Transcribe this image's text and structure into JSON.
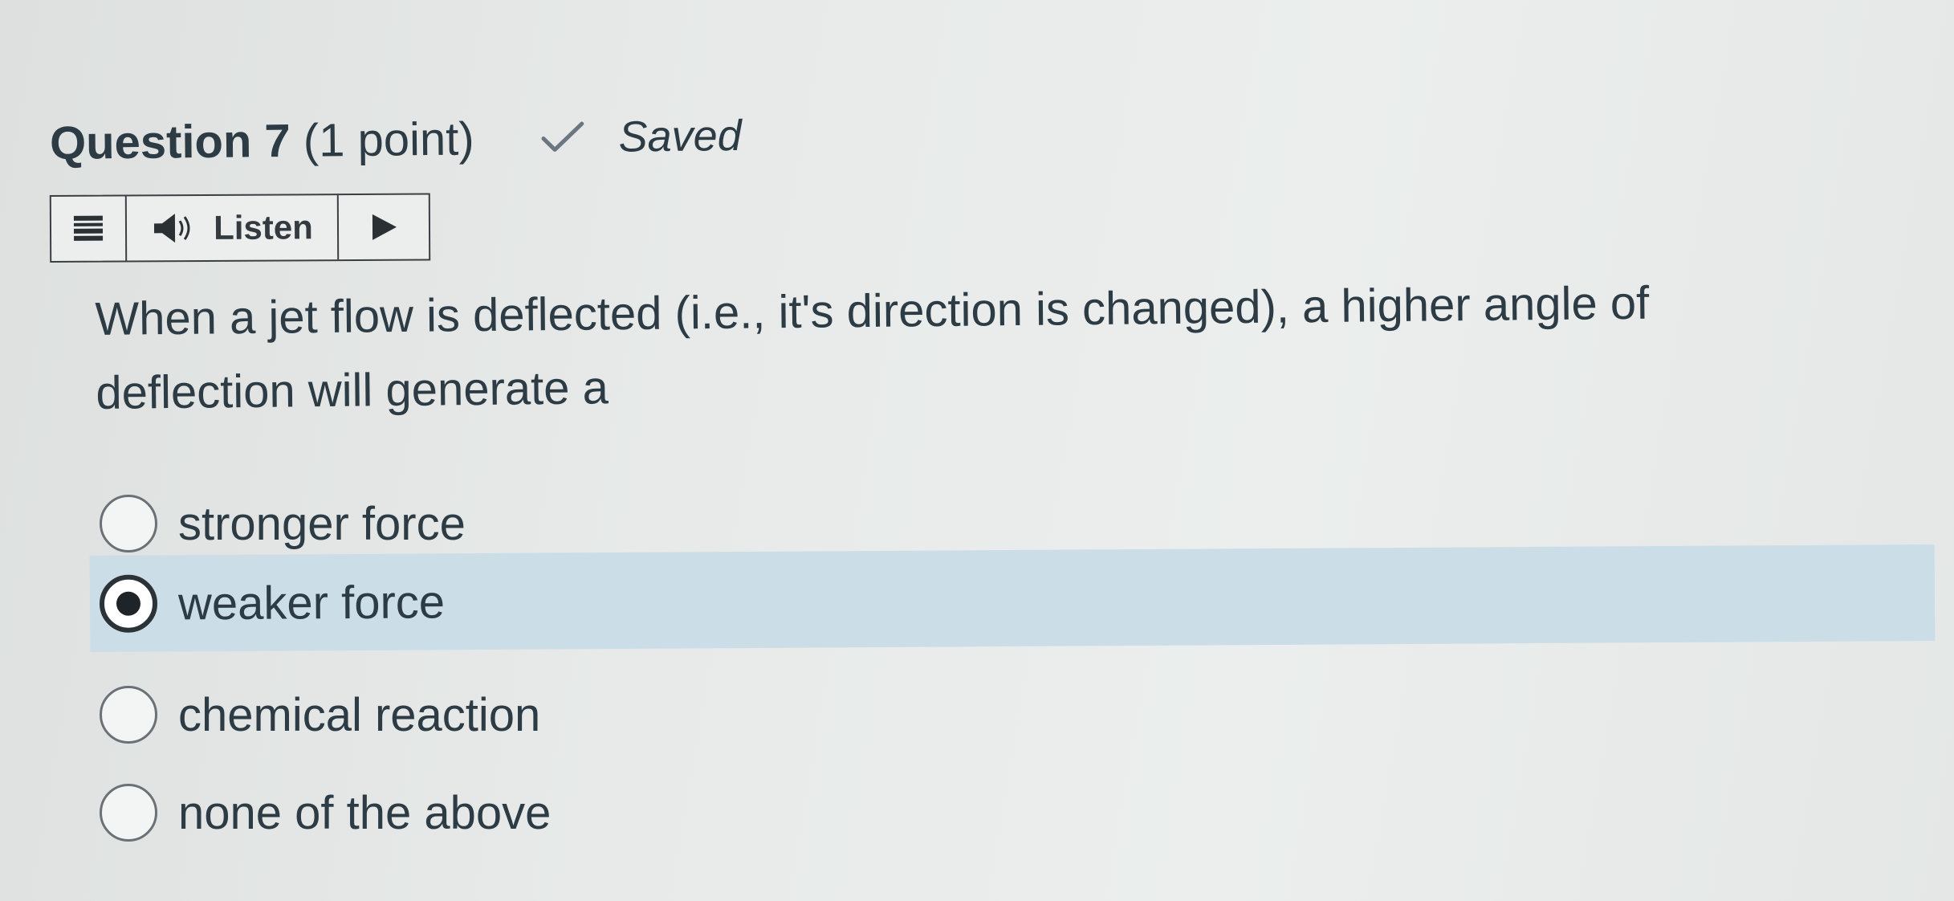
{
  "question": {
    "title_bold": "Question 7",
    "title_points": " (1 point)",
    "saved_label": "Saved",
    "text": "When a jet flow is deflected (i.e., it's direction is changed), a higher angle of deflection will generate a"
  },
  "listen_bar": {
    "label": "Listen",
    "icons": [
      "menu-icon",
      "speaker-icon",
      "play-icon"
    ]
  },
  "options": [
    {
      "label": "stronger force",
      "selected": false
    },
    {
      "label": "weaker force",
      "selected": true
    },
    {
      "label": "chemical reaction",
      "selected": false
    },
    {
      "label": "none of the above",
      "selected": false
    }
  ],
  "colors": {
    "text": "#2d3b45",
    "selected_row": "#cbdde7",
    "background": "#e6e9e8",
    "check": "#6b7780"
  }
}
